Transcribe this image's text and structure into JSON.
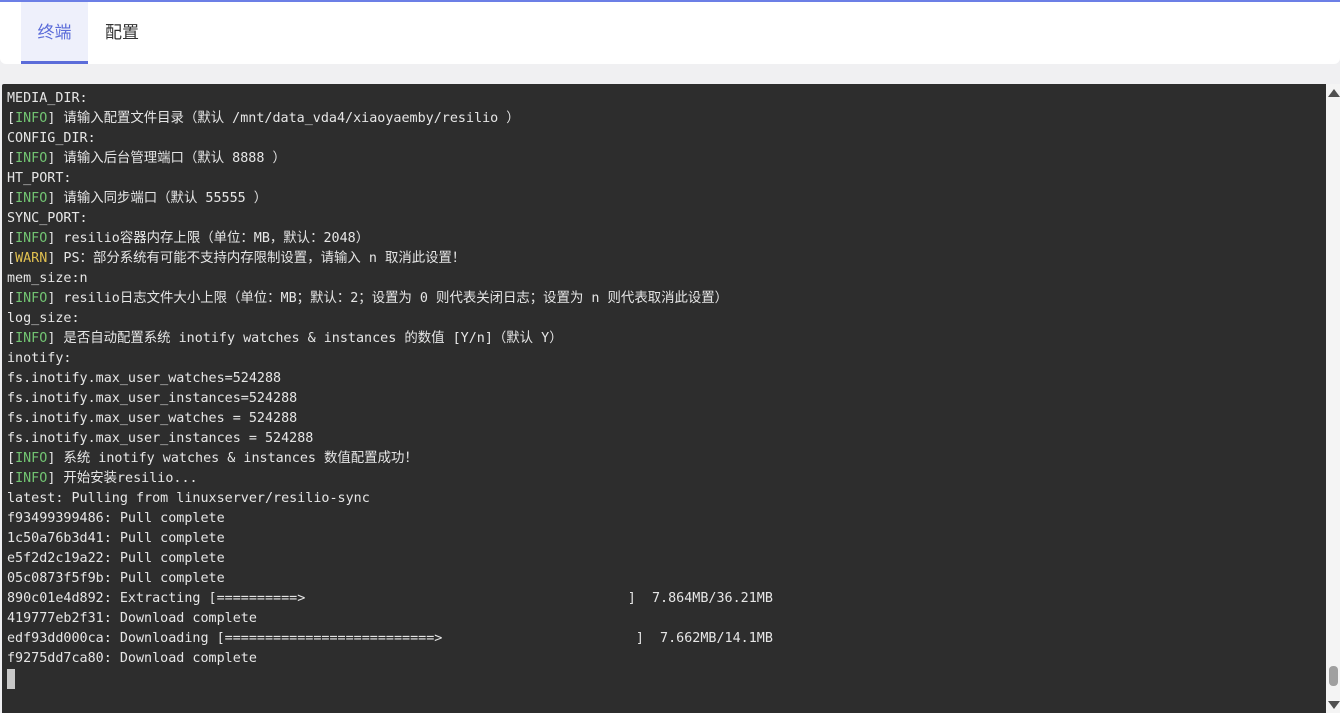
{
  "tabs": [
    {
      "label": "终端",
      "active": true
    },
    {
      "label": "配置",
      "active": false
    }
  ],
  "colors": {
    "accent": "#5b6cd9",
    "terminal_bg": "#2d2d2d",
    "info_tag": "#72c472",
    "warn_tag": "#e0c050"
  },
  "terminal": {
    "lines": [
      {
        "text": "MEDIA_DIR:"
      },
      {
        "tag": "INFO",
        "text": " 请输入配置文件目录（默认 /mnt/data_vda4/xiaoyaemby/resilio ）"
      },
      {
        "text": "CONFIG_DIR:"
      },
      {
        "tag": "INFO",
        "text": " 请输入后台管理端口（默认 8888 ）"
      },
      {
        "text": "HT_PORT:"
      },
      {
        "tag": "INFO",
        "text": " 请输入同步端口（默认 55555 ）"
      },
      {
        "text": "SYNC_PORT:"
      },
      {
        "tag": "INFO",
        "text": " resilio容器内存上限（单位：MB，默认：2048）"
      },
      {
        "tag": "WARN",
        "text": " PS：部分系统有可能不支持内存限制设置，请输入 n 取消此设置！"
      },
      {
        "text": "mem_size:n"
      },
      {
        "tag": "INFO",
        "text": " resilio日志文件大小上限（单位：MB；默认：2；设置为 0 则代表关闭日志；设置为 n 则代表取消此设置）"
      },
      {
        "text": "log_size:"
      },
      {
        "tag": "INFO",
        "text": " 是否自动配置系统 inotify watches & instances 的数值 [Y/n]（默认 Y）"
      },
      {
        "text": "inotify:"
      },
      {
        "text": "fs.inotify.max_user_watches=524288"
      },
      {
        "text": "fs.inotify.max_user_instances=524288"
      },
      {
        "text": "fs.inotify.max_user_watches = 524288"
      },
      {
        "text": "fs.inotify.max_user_instances = 524288"
      },
      {
        "tag": "INFO",
        "text": " 系统 inotify watches & instances 数值配置成功！"
      },
      {
        "tag": "INFO",
        "text": " 开始安装resilio..."
      },
      {
        "text": "latest: Pulling from linuxserver/resilio-sync"
      },
      {
        "text": "f93499399486: Pull complete"
      },
      {
        "text": "1c50a76b3d41: Pull complete"
      },
      {
        "text": "e5f2d2c19a22: Pull complete"
      },
      {
        "text": "05c0873f5f9b: Pull complete"
      },
      {
        "text": "890c01e4d892: Extracting [==========>                                        ]  7.864MB/36.21MB"
      },
      {
        "text": "419777eb2f31: Download complete"
      },
      {
        "text": "edf93dd000ca: Downloading [==========================>                        ]  7.662MB/14.1MB"
      },
      {
        "text": "f9275dd7ca80: Download complete"
      }
    ]
  }
}
